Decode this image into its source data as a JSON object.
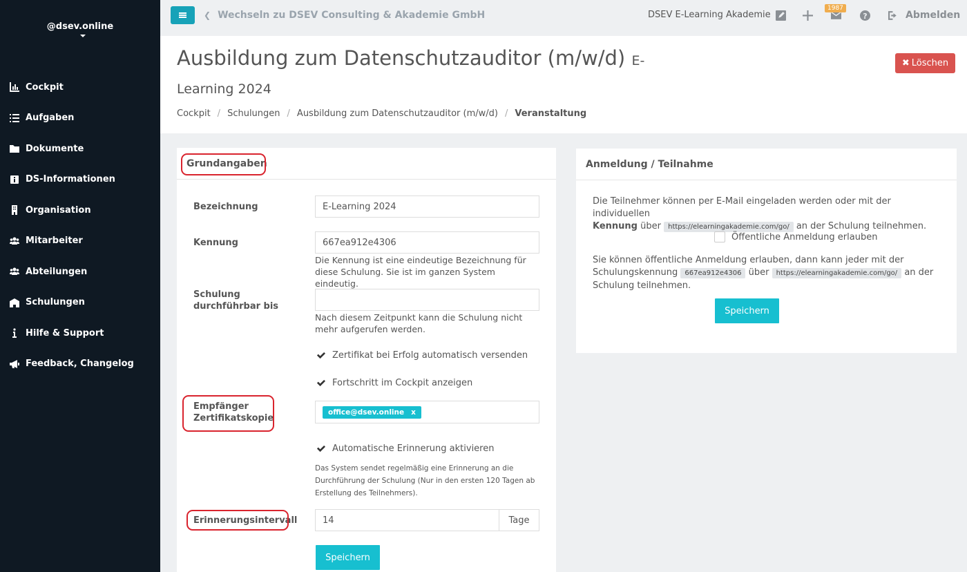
{
  "sidebar": {
    "brand": "@dsev.online",
    "items": [
      {
        "label": "Cockpit",
        "icon": "chart-icon"
      },
      {
        "label": "Aufgaben",
        "icon": "tasks-icon"
      },
      {
        "label": "Dokumente",
        "icon": "folder-icon"
      },
      {
        "label": "DS-Informationen",
        "icon": "info-icon"
      },
      {
        "label": "Organisation",
        "icon": "building-icon"
      },
      {
        "label": "Mitarbeiter",
        "icon": "users-icon"
      },
      {
        "label": "Abteilungen",
        "icon": "users-icon"
      },
      {
        "label": "Schulungen",
        "icon": "school-icon"
      },
      {
        "label": "Hilfe & Support",
        "icon": "info-icon"
      },
      {
        "label": "Feedback, Changelog",
        "icon": "megaphone-icon"
      }
    ]
  },
  "topbar": {
    "switch_label": "Wechseln zu DSEV Consulting & Akademie GmbH",
    "org_name": "DSEV E-Learning Akademie",
    "mail_count": "1987",
    "logout_label": "Abmelden"
  },
  "header": {
    "title_main": "Ausbildung zum Datenschutzauditor (m/w/d)",
    "title_sub_1": "E-",
    "title_sub_2": "Learning 2024",
    "delete_label": "Löschen",
    "breadcrumb": [
      "Cockpit",
      "Schulungen",
      "Ausbildung zum Datenschutzauditor (m/w/d)",
      "Veranstaltung"
    ]
  },
  "grund": {
    "heading": "Grundangaben",
    "bezeichnung_label": "Bezeichnung",
    "bezeichnung_value": "E-Learning 2024",
    "kennung_label": "Kennung",
    "kennung_value": "667ea912e4306",
    "kennung_help": "Die Kennung ist eine eindeutige Bezeichnung für diese Schulung. Sie ist im ganzen System eindeutig.",
    "schulung_label": "Schulung durchführbar bis",
    "schulung_value": "",
    "schulung_help": "Nach diesem Zeitpunkt kann die Schulung nicht mehr aufgerufen werden.",
    "zertifikat_check": "Zertifikat bei Erfolg automatisch versenden",
    "fortschritt_check": "Fortschritt im Cockpit anzeigen",
    "empfaenger_label": "Empfänger Zertifikatskopie",
    "empfaenger_tag": "office@dsev.online",
    "tag_remove": "x",
    "erinnerung_check": "Automatische Erinnerung aktivieren",
    "erinnerung_help": "Das System sendet regelmäßig eine Erinnerung an die Durchführung der Schulung (Nur in den ersten 120 Tagen ab Erstellung des Teilnehmers).",
    "intervall_label": "Erinnerungsintervall",
    "intervall_value": "14",
    "intervall_unit": "Tage",
    "save_label": "Speichern"
  },
  "anmeldung": {
    "heading": "Anmeldung / Teilnahme",
    "p1_a": "Die Teilnehmer können per E-Mail eingeladen werden oder mit der individuellen",
    "p1_bold": "Kennung",
    "p1_b": "über",
    "p1_url": "https://elearningakademie.com/go/",
    "p1_c": "an der Schulung teilnehmen.",
    "public_check": "Öffentliche Anmeldung erlauben",
    "p2_a": "Sie können öffentliche Anmeldung erlauben, dann kann jeder mit der",
    "p2_b": "Schulungskennung",
    "p2_code": "667ea912e4306",
    "p2_c": "über",
    "p2_url": "https://elearningakademie.com/go/",
    "p2_d": "an der",
    "p2_e": "Schulung teilnehmen.",
    "save_label": "Speichern"
  },
  "colors": {
    "sidebar_bg": "#0f1923",
    "accent": "#17bfd0",
    "danger": "#d9534f",
    "annotation": "#d9232d"
  }
}
